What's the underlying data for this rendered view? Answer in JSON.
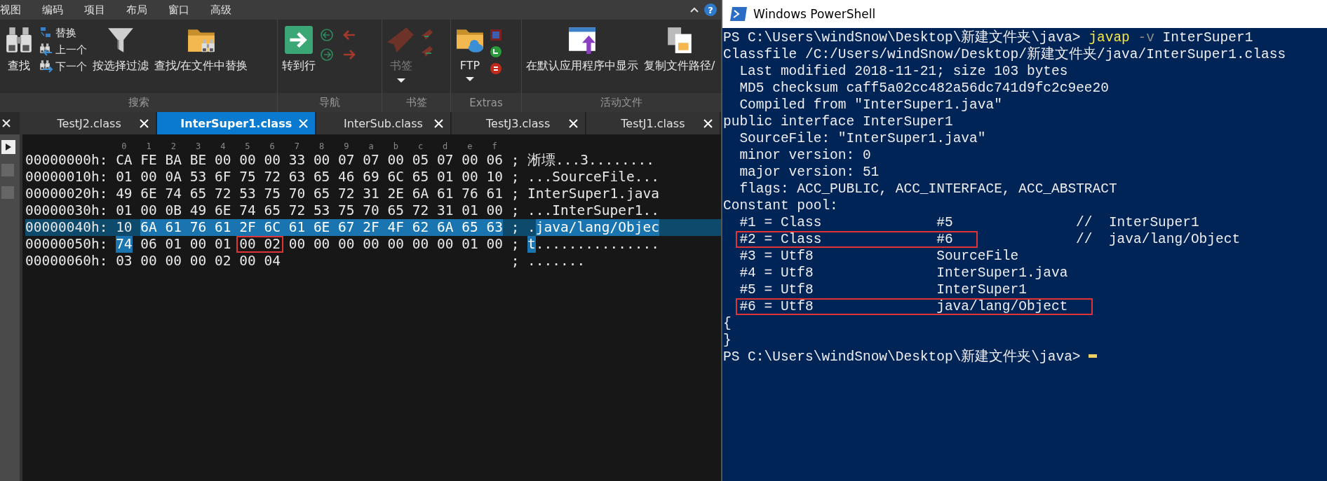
{
  "editor": {
    "menu": [
      {
        "label": "视图"
      },
      {
        "label": "编码"
      },
      {
        "label": "项目"
      },
      {
        "label": "布局"
      },
      {
        "label": "窗口"
      },
      {
        "label": "高级"
      }
    ],
    "help": "?",
    "ribbon": [
      {
        "label": "搜索",
        "items": [
          {
            "kind": "large",
            "label": "查找",
            "disabled": false,
            "dropdown": false
          },
          {
            "kind": "stack",
            "entries": [
              {
                "label": "替换"
              },
              {
                "label": "上一个"
              },
              {
                "label": "下一个"
              }
            ]
          },
          {
            "kind": "large",
            "label": "按选择过滤",
            "disabled": false,
            "dropdown": false
          },
          {
            "kind": "large",
            "label": "查找/在文件中替换",
            "disabled": false,
            "dropdown": false
          }
        ]
      },
      {
        "label": "导航",
        "items": [
          {
            "kind": "large",
            "label": "转到行",
            "disabled": false,
            "dropdown": false
          },
          {
            "kind": "grid"
          }
        ]
      },
      {
        "label": "书签",
        "items": [
          {
            "kind": "large",
            "label": "书签",
            "disabled": true,
            "dropdown": true
          },
          {
            "kind": "grid"
          }
        ]
      },
      {
        "label": "Extras",
        "items": [
          {
            "kind": "large",
            "label": "FTP",
            "disabled": false,
            "dropdown": true
          },
          {
            "kind": "grid"
          }
        ]
      },
      {
        "label": "活动文件",
        "items": [
          {
            "kind": "large",
            "label": "在默认应用程序中显示",
            "disabled": false,
            "dropdown": false
          },
          {
            "kind": "large",
            "label": "复制文件路径/",
            "disabled": false,
            "dropdown": false
          }
        ]
      }
    ],
    "tabs": [
      {
        "label": "TestJ2.class",
        "selected": false
      },
      {
        "label": "InterSuper1.class",
        "selected": true
      },
      {
        "label": "InterSub.class",
        "selected": false
      },
      {
        "label": "TestJ3.class",
        "selected": false
      },
      {
        "label": "TestJ1.class",
        "selected": false
      }
    ],
    "ruler": [
      "0",
      "1",
      "2",
      "3",
      "4",
      "5",
      "6",
      "7",
      "8",
      "9",
      "a",
      "b",
      "c",
      "d",
      "e",
      "f"
    ],
    "rows": [
      {
        "offset": "00000000h:",
        "current": false,
        "bytes": [
          {
            "text": "CA FE BA BE 00 00 00 33 00 07 07 00 05 07 00 06",
            "selected": false,
            "marked": false
          }
        ],
        "separator": ";",
        "ascii": [
          {
            "text": "淅墂...3........",
            "selected": false
          }
        ]
      },
      {
        "offset": "00000010h:",
        "current": false,
        "bytes": [
          {
            "text": "01 00 0A 53 6F 75 72 63 65 46 69 6C 65 01 00 10",
            "selected": false,
            "marked": false
          }
        ],
        "separator": ";",
        "ascii": [
          {
            "text": "...SourceFile...",
            "selected": false
          }
        ]
      },
      {
        "offset": "00000020h:",
        "current": false,
        "bytes": [
          {
            "text": "49 6E 74 65 72 53 75 70 65 72 31 2E 6A 61 76 61",
            "selected": false,
            "marked": false
          }
        ],
        "separator": ";",
        "ascii": [
          {
            "text": "InterSuper1.java",
            "selected": false
          }
        ]
      },
      {
        "offset": "00000030h:",
        "current": false,
        "bytes": [
          {
            "text": "01 00 0B 49 6E 74 65 72 53 75 70 65 72 31 01 00",
            "selected": false,
            "marked": false
          }
        ],
        "separator": ";",
        "ascii": [
          {
            "text": "...InterSuper1..",
            "selected": false
          }
        ]
      },
      {
        "offset": "00000040h:",
        "current": true,
        "bytes": [
          {
            "text": "10",
            "selected": false,
            "marked": false
          },
          {
            "text": "6A 61 76 61 2F 6C 61 6E 67 2F 4F 62 6A 65 63",
            "selected": true,
            "marked": false
          }
        ],
        "separator": ";",
        "ascii": [
          {
            "text": ".",
            "selected": false
          },
          {
            "text": "java/lang/Objec",
            "selected": true
          }
        ]
      },
      {
        "offset": "00000050h:",
        "current": false,
        "bytes": [
          {
            "text": "74",
            "selected": true,
            "marked": false
          },
          {
            "text": "06 01 00 01",
            "selected": false,
            "marked": false
          },
          {
            "text": "00 02",
            "selected": false,
            "marked": true
          },
          {
            "text": "00 00 00 00 00 00 00 01 00",
            "selected": false,
            "marked": false
          }
        ],
        "separator": ";",
        "ascii": [
          {
            "text": "t",
            "selected": true
          },
          {
            "text": "...............",
            "selected": false
          }
        ]
      },
      {
        "offset": "00000060h:",
        "current": false,
        "bytes": [
          {
            "text": "03 00 00 00 02 00 04",
            "selected": false,
            "marked": false
          }
        ],
        "separator": ";",
        "ascii": [
          {
            "text": ".......",
            "selected": false
          }
        ]
      }
    ]
  },
  "powershell": {
    "title": "Windows PowerShell",
    "cursor": true,
    "lines": [
      {
        "kind": "text",
        "indent": false,
        "segments": [
          {
            "text": "PS C:\\Users\\windSnow\\Desktop\\新建文件夹\\java>",
            "kind": "prompt"
          },
          {
            "text": "javap",
            "kind": "command"
          },
          {
            "text": "-v",
            "kind": "param"
          },
          {
            "text": "InterSuper1",
            "kind": "plain"
          }
        ]
      },
      {
        "kind": "text",
        "indent": false,
        "segments": [
          {
            "text": "Classfile /C:/Users/windSnow/Desktop/新建文件夹/java/InterSuper1.class",
            "kind": "plain"
          }
        ]
      },
      {
        "kind": "text",
        "indent": true,
        "segments": [
          {
            "text": "Last modified 2018-11-21; size 103 bytes",
            "kind": "plain"
          }
        ]
      },
      {
        "kind": "text",
        "indent": true,
        "segments": [
          {
            "text": "MD5 checksum caff5a02cc482a56dc741d9fc2c9ee20",
            "kind": "plain"
          }
        ]
      },
      {
        "kind": "text",
        "indent": true,
        "segments": [
          {
            "text": "Compiled from \"InterSuper1.java\"",
            "kind": "plain"
          }
        ]
      },
      {
        "kind": "text",
        "indent": false,
        "segments": [
          {
            "text": "public interface InterSuper1",
            "kind": "plain"
          }
        ]
      },
      {
        "kind": "text",
        "indent": true,
        "segments": [
          {
            "text": "SourceFile: \"InterSuper1.java\"",
            "kind": "plain"
          }
        ]
      },
      {
        "kind": "text",
        "indent": true,
        "segments": [
          {
            "text": "minor version: 0",
            "kind": "plain"
          }
        ]
      },
      {
        "kind": "text",
        "indent": true,
        "segments": [
          {
            "text": "major version: 51",
            "kind": "plain"
          }
        ]
      },
      {
        "kind": "text",
        "indent": true,
        "segments": [
          {
            "text": "flags: ACC_PUBLIC, ACC_INTERFACE, ACC_ABSTRACT",
            "kind": "plain"
          }
        ]
      },
      {
        "kind": "text",
        "indent": false,
        "segments": [
          {
            "text": "Constant pool:",
            "kind": "plain"
          }
        ]
      },
      {
        "kind": "entry",
        "entry": "#1 = Class",
        "value": "#5",
        "comment": "//  InterSuper1",
        "marked": false
      },
      {
        "kind": "entry",
        "entry": "#2 = Class",
        "value": "#6",
        "comment": "//  java/lang/Object",
        "marked": true
      },
      {
        "kind": "entry",
        "entry": "#3 = Utf8",
        "value": "SourceFile",
        "marked": false
      },
      {
        "kind": "entry",
        "entry": "#4 = Utf8",
        "value": "InterSuper1.java",
        "marked": false
      },
      {
        "kind": "entry",
        "entry": "#5 = Utf8",
        "value": "InterSuper1",
        "marked": false
      },
      {
        "kind": "entry",
        "entry": "#6 = Utf8",
        "value": "java/lang/Object",
        "marked": true
      },
      {
        "kind": "text",
        "indent": false,
        "segments": [
          {
            "text": "{",
            "kind": "plain"
          }
        ]
      },
      {
        "kind": "text",
        "indent": false,
        "segments": [
          {
            "text": "}",
            "kind": "plain"
          }
        ]
      },
      {
        "kind": "text",
        "indent": false,
        "segments": [
          {
            "text": "PS C:\\Users\\windSnow\\Desktop\\新建文件夹\\java>",
            "kind": "prompt"
          }
        ]
      }
    ]
  }
}
